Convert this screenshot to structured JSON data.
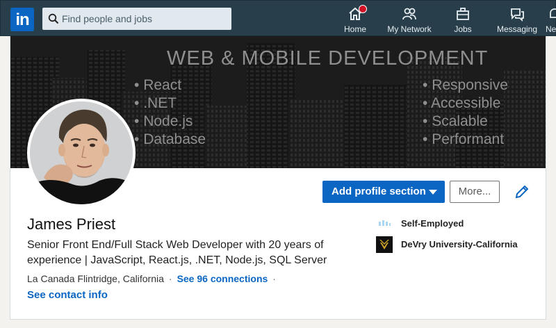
{
  "colors": {
    "topbar": "#283e4a",
    "brand_blue": "#0a66c2",
    "notification_badge": "#d11124"
  },
  "topbar": {
    "logo_text": "in",
    "search_placeholder": "Find people and jobs",
    "nav": [
      {
        "label": "Home",
        "icon": "home-icon",
        "badge": true
      },
      {
        "label": "My Network",
        "icon": "network-icon"
      },
      {
        "label": "Jobs",
        "icon": "briefcase-icon"
      },
      {
        "label": "Messaging",
        "icon": "messaging-icon"
      },
      {
        "label": "Ne",
        "icon": "notifications-icon"
      }
    ]
  },
  "banner": {
    "title": "WEB & MOBILE DEVELOPMENT",
    "left_bullets": [
      "React",
      ".NET",
      "Node.js",
      "Database"
    ],
    "right_bullets": [
      "Responsive",
      "Accessible",
      "Scalable",
      "Performant"
    ]
  },
  "actions": {
    "add_section": "Add profile section",
    "more": "More..."
  },
  "profile": {
    "name": "James Priest",
    "headline": "Senior Front End/Full Stack Web Developer with 20 years of experience | JavaScript, React.js, .NET, Node.js, SQL Server",
    "location": "La Canada Flintridge, California",
    "connections": "See 96 connections",
    "contact": "See contact info"
  },
  "orgs": [
    {
      "label": "Self-Employed",
      "icon": "company-icon"
    },
    {
      "label": "DeVry University-California",
      "icon": "school-logo-icon"
    }
  ]
}
